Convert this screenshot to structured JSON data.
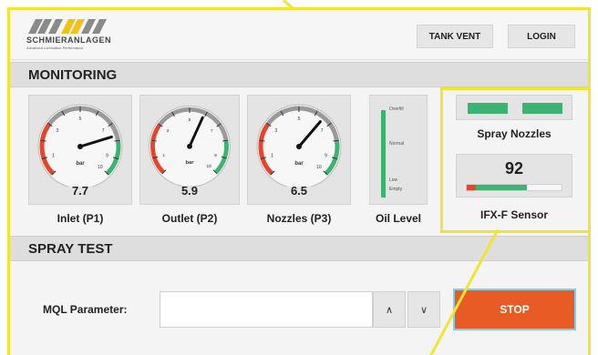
{
  "header": {
    "logo_name": "SCHMIERANLAGEN",
    "logo_tagline": "Advanced Lubrication Performance",
    "tank_vent_label": "TANK VENT",
    "login_label": "LOGIN"
  },
  "monitoring": {
    "title": "MONITORING",
    "gauges": [
      {
        "label": "Inlet (P1)",
        "value": "7.7",
        "unit": "bar",
        "reading": 7.7
      },
      {
        "label": "Outlet (P2)",
        "value": "5.9",
        "unit": "bar",
        "reading": 5.9
      },
      {
        "label": "Nozzles (P3)",
        "value": "6.5",
        "unit": "bar",
        "reading": 6.5
      }
    ],
    "oil_level": {
      "label": "Oil Level",
      "marks": [
        "Overfill",
        "Normal",
        "Low",
        "Empty"
      ]
    },
    "spray_nozzles": {
      "label": "Spray Nozzles"
    },
    "ifx_sensor": {
      "label": "IFX-F Sensor",
      "value": "92"
    }
  },
  "spray_test": {
    "title": "SPRAY TEST",
    "parameter_label": "MQL Parameter:",
    "parameter_value": "",
    "up_label": "∧",
    "down_label": "∨",
    "stop_label": "STOP"
  },
  "colors": {
    "accent_highlight": "#f2e530",
    "stop_button": "#e95b25",
    "ok_green": "#3cb371",
    "alarm_red": "#e8442a"
  }
}
